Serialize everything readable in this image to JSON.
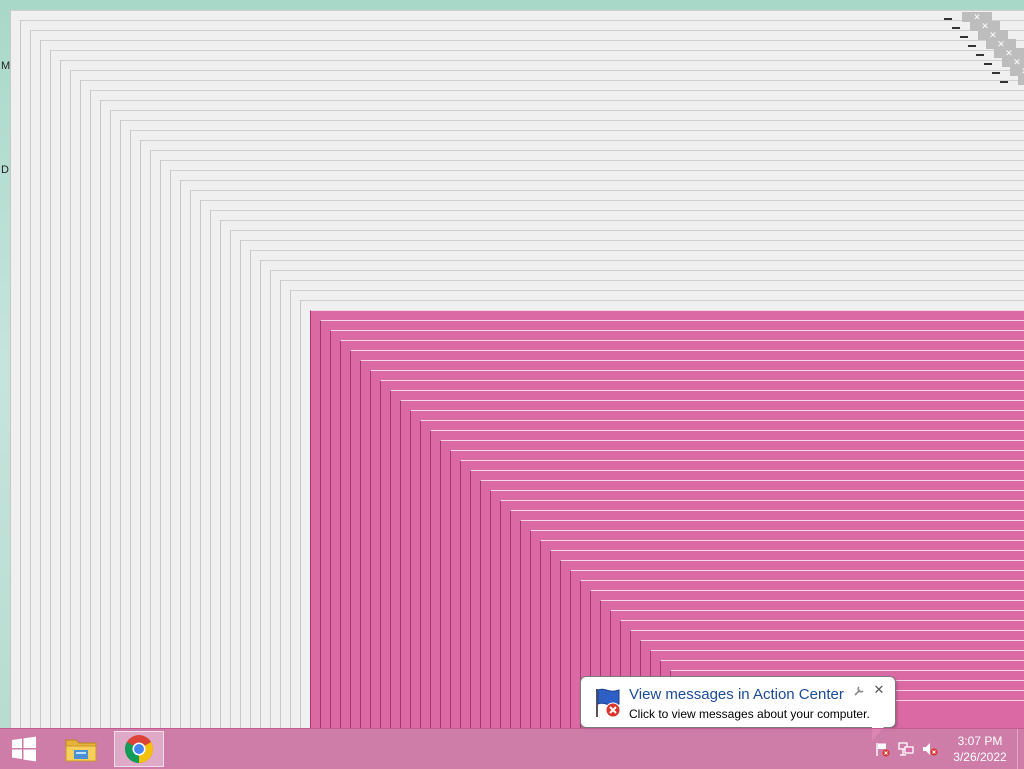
{
  "desktop": {
    "side_letters": [
      "M",
      "D"
    ],
    "ghost_window_close_glyph": "✕"
  },
  "balloon": {
    "title": "View messages in Action Center",
    "body": "Click to view messages about your computer.",
    "close_glyph": "✕",
    "options_icon": "wrench-icon"
  },
  "taskbar": {
    "start_icon": "windows-logo-icon",
    "pinned": [
      {
        "name": "File Explorer",
        "icon": "folder-icon"
      },
      {
        "name": "Google Chrome",
        "icon": "chrome-icon",
        "active": true
      }
    ],
    "tray": {
      "icons": [
        "action-center-flag-icon",
        "network-icon",
        "volume-muted-icon"
      ],
      "time": "3:07 PM",
      "date": "3/26/2022"
    }
  },
  "colors": {
    "taskbar": "#d66ea5",
    "pink_window": "#db6aa4",
    "gray_window": "#f0f0f0",
    "balloon_title": "#1a4a9c",
    "desktop": "#a8d8c8"
  }
}
